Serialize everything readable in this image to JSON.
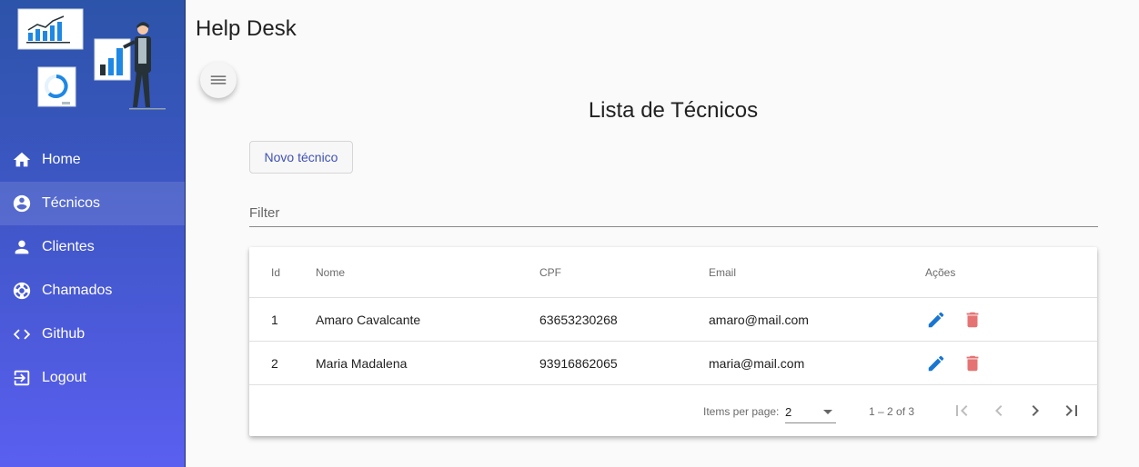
{
  "app": {
    "title": "Help Desk"
  },
  "sidebar": {
    "items": [
      {
        "label": "Home",
        "icon": "home-icon",
        "active": false
      },
      {
        "label": "Técnicos",
        "icon": "account-circle-icon",
        "active": true
      },
      {
        "label": "Clientes",
        "icon": "person-icon",
        "active": false
      },
      {
        "label": "Chamados",
        "icon": "support-icon",
        "active": false
      },
      {
        "label": "Github",
        "icon": "code-icon",
        "active": false
      },
      {
        "label": "Logout",
        "icon": "logout-icon",
        "active": false
      }
    ]
  },
  "page": {
    "title": "Lista de Técnicos",
    "new_button": "Novo técnico",
    "filter_placeholder": "Filter"
  },
  "table": {
    "columns": [
      "Id",
      "Nome",
      "CPF",
      "Email",
      "Ações"
    ],
    "rows": [
      {
        "id": "1",
        "nome": "Amaro Cavalcante",
        "cpf": "63653230268",
        "email": "amaro@mail.com"
      },
      {
        "id": "2",
        "nome": "Maria Madalena",
        "cpf": "93916862065",
        "email": "maria@mail.com"
      }
    ]
  },
  "paginator": {
    "items_per_page_label": "Items per page:",
    "items_per_page": "2",
    "range": "1 – 2 of 3"
  },
  "colors": {
    "sidebar_top": "#2c54a9",
    "sidebar_bottom": "#5a5ff0",
    "edit_icon": "#1976d2",
    "delete_icon": "#e57373",
    "primary": "#3f51b5"
  }
}
